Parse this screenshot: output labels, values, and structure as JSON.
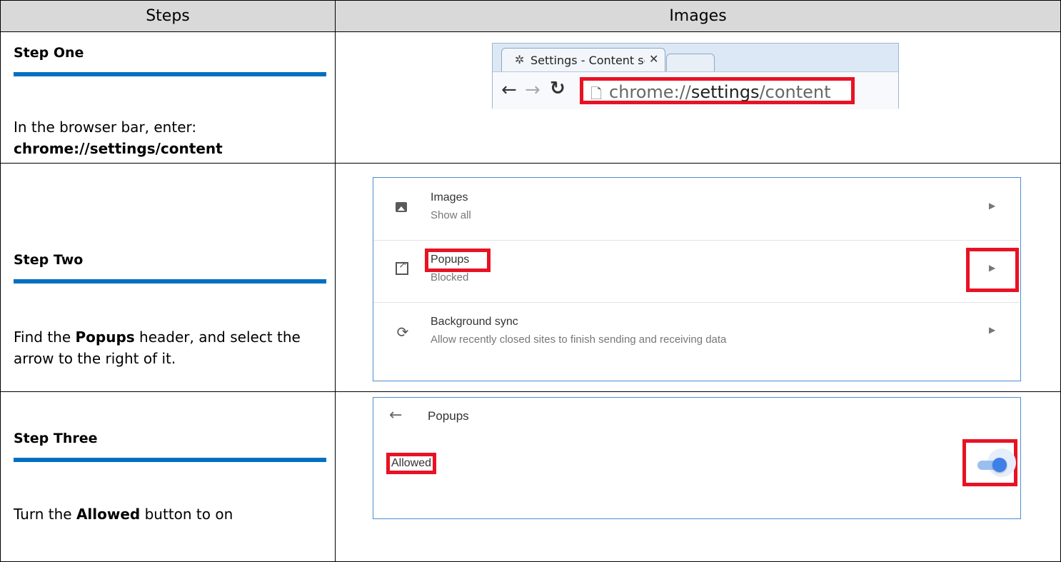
{
  "header": {
    "steps": "Steps",
    "images": "Images"
  },
  "steps": [
    {
      "heading": "Step One",
      "text_before": "In the browser bar, enter:",
      "text_bold": "chrome://settings/content"
    },
    {
      "heading": "Step Two",
      "text_before": "Find the ",
      "text_bold": "Popups",
      "text_after": " header, and select the arrow to the right of it."
    },
    {
      "heading": "Step Three",
      "text_before": "Turn the ",
      "text_bold": "Allowed",
      "text_after": " button to on"
    }
  ],
  "browser": {
    "tab_title": "Settings - Content setting",
    "url_prefix": "chrome://",
    "url_strong": "settings",
    "url_suffix": "/content",
    "icons": [
      "gear-icon",
      "close-icon",
      "back-arrow-icon",
      "forward-arrow-icon",
      "reload-icon",
      "document-icon"
    ]
  },
  "content_settings": [
    {
      "title": "Images",
      "subtitle": "Show all",
      "icon": "image-icon"
    },
    {
      "title": "Popups",
      "subtitle": "Blocked",
      "icon": "open-in-new-icon"
    },
    {
      "title": "Background sync",
      "subtitle": "Allow recently closed sites to finish sending and receiving data",
      "icon": "sync-icon"
    }
  ],
  "popups_page": {
    "title": "Popups",
    "allowed_label": "Allowed",
    "toggle_on": true
  },
  "colors": {
    "header_bg": "#d9d9d9",
    "rule_blue": "#0070c0",
    "highlight_red": "#e81224",
    "toggle_blue": "#3f7fe8"
  }
}
